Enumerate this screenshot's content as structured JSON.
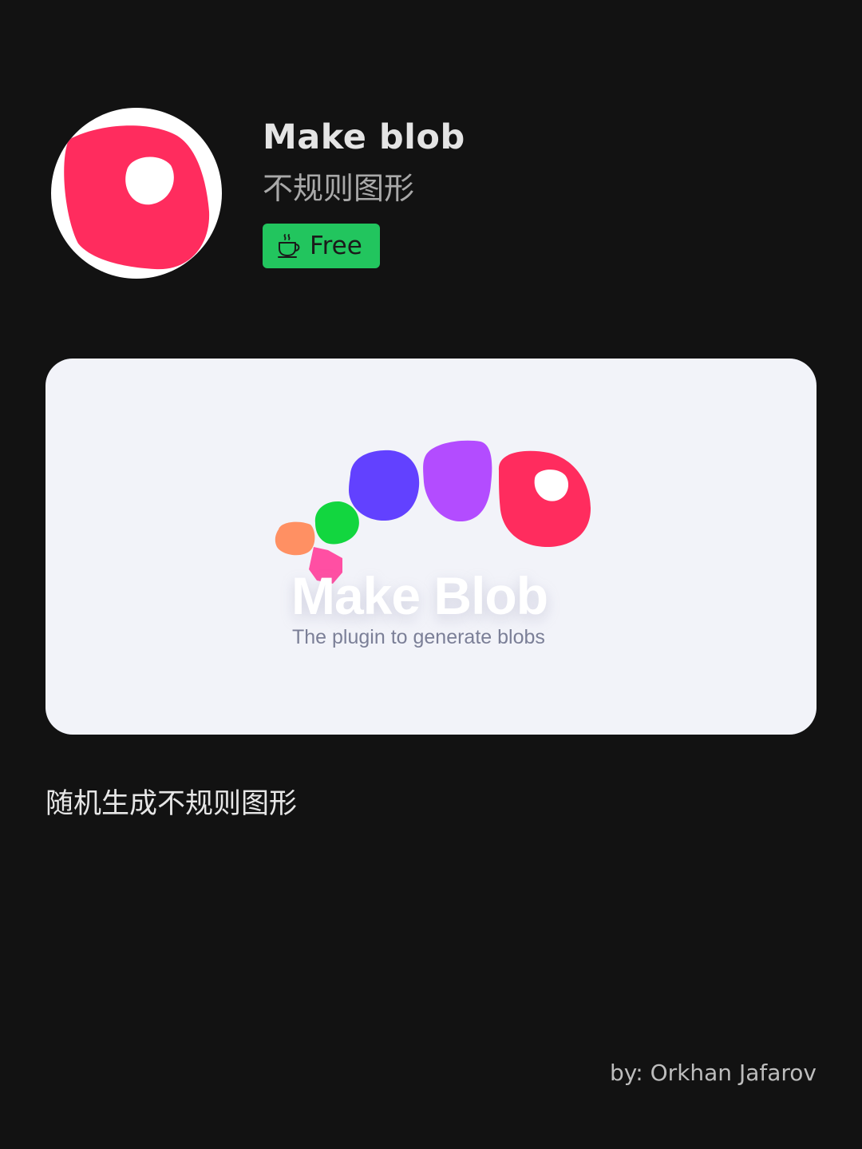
{
  "app": {
    "title": "Make blob",
    "subtitle": "不规则图形",
    "price_label": "Free",
    "price_icon": "coffee-cup-icon"
  },
  "preview": {
    "brand_title": "Make Blob",
    "brand_tagline": "The plugin to generate blobs",
    "blob_colors": [
      "#ff9063",
      "#ff4fa3",
      "#12d63f",
      "#6241ff",
      "#b34cff",
      "#ff2c5e"
    ]
  },
  "description": "随机生成不规则图形",
  "author": "by:  Orkhan Jafarov",
  "colors": {
    "background": "#121212",
    "badge": "#22c55e",
    "brand_red": "#ff2c5e",
    "card": "#f2f3f9"
  }
}
